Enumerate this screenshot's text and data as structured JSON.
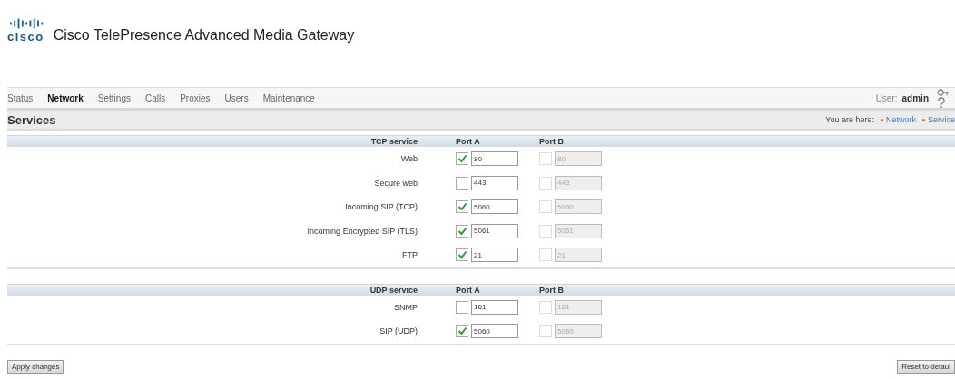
{
  "header": {
    "logo_text": "cisco",
    "title": "Cisco TelePresence Advanced Media Gateway"
  },
  "nav": {
    "tabs": [
      {
        "label": "Status",
        "selected": false
      },
      {
        "label": "Network",
        "selected": true
      },
      {
        "label": "Settings",
        "selected": false
      },
      {
        "label": "Calls",
        "selected": false
      },
      {
        "label": "Proxies",
        "selected": false
      },
      {
        "label": "Users",
        "selected": false
      },
      {
        "label": "Maintenance",
        "selected": false
      }
    ],
    "user_label": "User:",
    "user_name": "admin"
  },
  "page": {
    "title": "Services",
    "breadcrumb_label": "You are here:",
    "breadcrumb": [
      "Network",
      "Service"
    ]
  },
  "tables": [
    {
      "columns": [
        "TCP service",
        "Port A",
        "Port B"
      ],
      "rows": [
        {
          "service": "Web",
          "port_a": {
            "checked": true,
            "value": "80",
            "disabled": false
          },
          "port_b": {
            "checked": false,
            "value": "80",
            "disabled": true
          }
        },
        {
          "service": "Secure web",
          "port_a": {
            "checked": false,
            "value": "443",
            "disabled": false
          },
          "port_b": {
            "checked": false,
            "value": "443",
            "disabled": true
          }
        },
        {
          "service": "Incoming SIP (TCP)",
          "port_a": {
            "checked": true,
            "value": "5060",
            "disabled": false
          },
          "port_b": {
            "checked": false,
            "value": "5060",
            "disabled": true
          }
        },
        {
          "service": "Incoming Encrypted SIP (TLS)",
          "port_a": {
            "checked": true,
            "value": "5061",
            "disabled": false
          },
          "port_b": {
            "checked": false,
            "value": "5061",
            "disabled": true
          }
        },
        {
          "service": "FTP",
          "port_a": {
            "checked": true,
            "value": "21",
            "disabled": false
          },
          "port_b": {
            "checked": false,
            "value": "21",
            "disabled": true
          }
        }
      ]
    },
    {
      "columns": [
        "UDP service",
        "Port A",
        "Port B"
      ],
      "rows": [
        {
          "service": "SNMP",
          "port_a": {
            "checked": false,
            "value": "161",
            "disabled": false
          },
          "port_b": {
            "checked": false,
            "value": "161",
            "disabled": true
          }
        },
        {
          "service": "SIP (UDP)",
          "port_a": {
            "checked": true,
            "value": "5060",
            "disabled": false
          },
          "port_b": {
            "checked": false,
            "value": "5060",
            "disabled": true
          }
        }
      ]
    }
  ],
  "buttons": {
    "apply": "Apply changes",
    "reset": "Reset to defaul"
  }
}
